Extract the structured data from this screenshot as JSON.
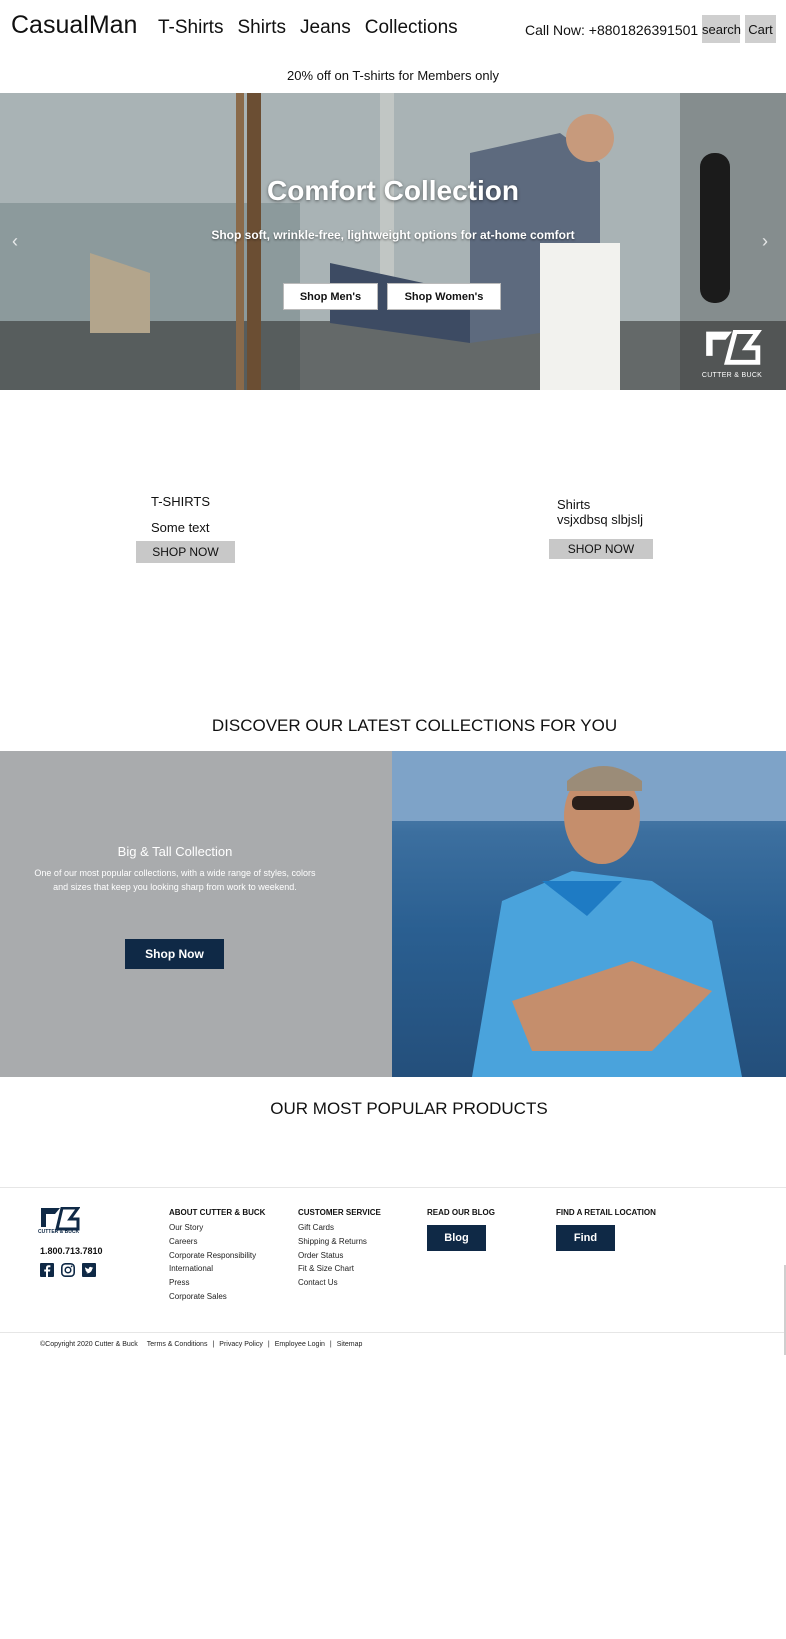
{
  "header": {
    "brand": "CasualMan",
    "nav": [
      "T-Shirts",
      "Shirts",
      "Jeans",
      "Collections"
    ],
    "call": "Call Now: +8801826391501",
    "search_label": "search",
    "cart_label": "Cart"
  },
  "promo": "20% off  on T-shirts for Members only",
  "hero": {
    "title": "Comfort Collection",
    "subtitle": "Shop soft, wrinkle-free, lightweight options for at-home comfort",
    "btn_men": "Shop Men's",
    "btn_women": "Shop Women's",
    "prev": "‹",
    "next": "›",
    "logo_text": "CUTTER & BUCK"
  },
  "categories": [
    {
      "title": "T-SHIRTS",
      "text": "Some text",
      "button": "SHOP NOW"
    },
    {
      "title": "Shirts",
      "text": "vsjxdbsq slbjslj",
      "button": "SHOP NOW"
    }
  ],
  "discover": {
    "title": "DISCOVER OUR LATEST COLLECTIONS FOR YOU",
    "feature_title": "Big & Tall Collection",
    "feature_desc": "One of our most popular collections, with a wide range of styles, colors and sizes that keep you looking sharp from work to weekend.",
    "feature_button": "Shop Now"
  },
  "popular_title": "OUR MOST POPULAR PRODUCTS",
  "footer": {
    "logo_text": "CUTTER & BUCK",
    "phone": "1.800.713.7810",
    "about": {
      "heading": "ABOUT CUTTER & BUCK",
      "items": [
        "Our Story",
        "Careers",
        "Corporate Responsibility",
        "International",
        "Press",
        "Corporate Sales"
      ]
    },
    "service": {
      "heading": "CUSTOMER SERVICE",
      "items": [
        "Gift Cards",
        "Shipping & Returns",
        "Order Status",
        "Fit & Size Chart",
        "Contact Us"
      ]
    },
    "blog": {
      "heading": "READ OUR BLOG",
      "button": "Blog"
    },
    "retail": {
      "heading": "FIND A RETAIL LOCATION",
      "button": "Find"
    },
    "legal": {
      "copyright": "©Copyright 2020 Cutter & Buck",
      "links": [
        "Terms & Conditions",
        "|",
        "Privacy Policy",
        "|",
        "Employee Login",
        "|",
        "Sitemap"
      ]
    }
  },
  "colors": {
    "navy": "#0f2946",
    "gray_button": "#c8c8c8",
    "feature_gray": "#a9abad"
  }
}
